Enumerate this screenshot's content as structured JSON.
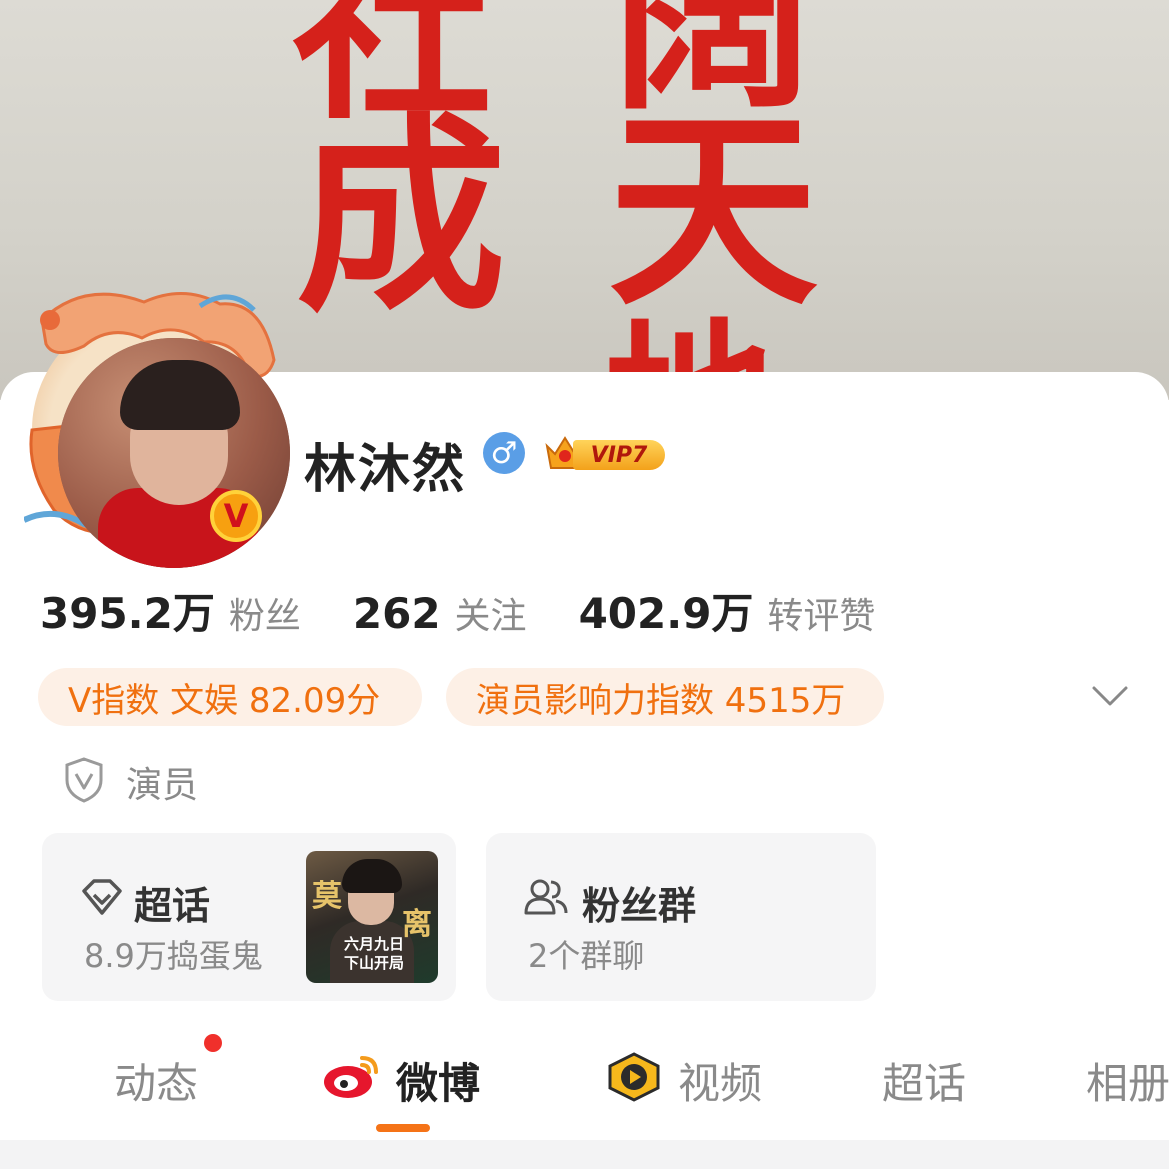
{
  "cover": {
    "characters": [
      "社",
      "阔",
      "成",
      "天",
      "地"
    ]
  },
  "profile": {
    "name": "林沐然",
    "gender_symbol": "♂",
    "vip_label": "VIP7",
    "verified_badge": "V"
  },
  "stats": [
    {
      "value": "395.2万",
      "label": "粉丝"
    },
    {
      "value": "262",
      "label": "关注"
    },
    {
      "value": "402.9万",
      "label": "转评赞"
    }
  ],
  "chips": [
    {
      "label": "V指数 文娱 82.09分"
    },
    {
      "label": "演员影响力指数 4515万"
    }
  ],
  "role": {
    "label": "演员"
  },
  "feature_cards": [
    {
      "title": "超话",
      "subtitle": "8.9万捣蛋鬼",
      "poster": {
        "title_1": "莫",
        "title_2": "离",
        "caption": "六月九日 下山开局"
      }
    },
    {
      "title": "粉丝群",
      "subtitle": "2个群聊"
    }
  ],
  "tabs": [
    {
      "label": "动态",
      "has_dot": true
    },
    {
      "label": "微博",
      "active": true
    },
    {
      "label": "视频"
    },
    {
      "label": "超话"
    },
    {
      "label": "相册"
    }
  ],
  "colors": {
    "accent": "#f57317",
    "chip_bg": "#fdf0e6",
    "chip_text": "#f0700f",
    "cover_red": "#d5211b",
    "notification_dot": "#f0302b"
  }
}
